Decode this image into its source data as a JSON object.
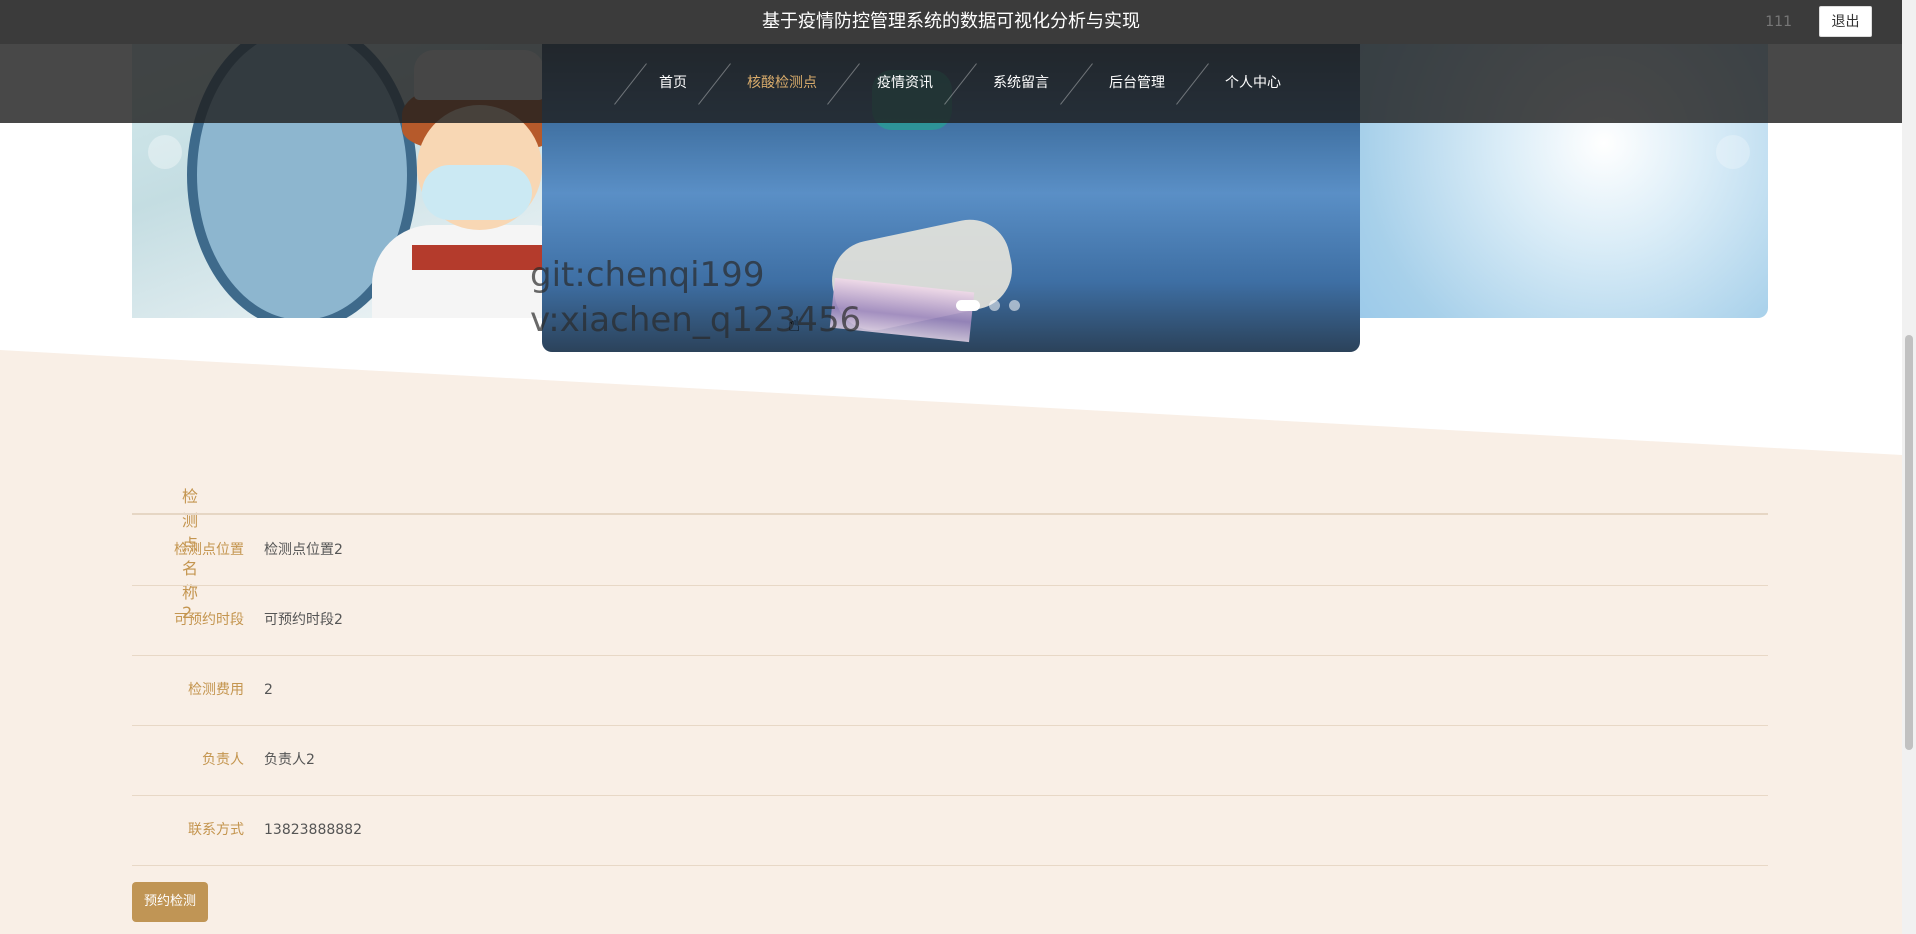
{
  "header": {
    "site_title": "基于疫情防控管理系统的数据可视化分析与实现",
    "username": "111",
    "logout_label": "退出"
  },
  "nav": {
    "items": [
      {
        "label": "首页",
        "active": false
      },
      {
        "label": "核酸检测点",
        "active": true
      },
      {
        "label": "疫情资讯",
        "active": false
      },
      {
        "label": "系统留言",
        "active": false
      },
      {
        "label": "后台管理",
        "active": false
      },
      {
        "label": "个人中心",
        "active": false
      }
    ]
  },
  "carousel": {
    "watermark_line1": "git:chenqi199",
    "watermark_line2": "v:xiachen_q123456",
    "slide_count": 3,
    "active_slide": 1
  },
  "detail": {
    "title": "检测点名称2",
    "rows": [
      {
        "label": "检测点位置",
        "value": "检测点位置2"
      },
      {
        "label": "可预约时段",
        "value": "可预约时段2"
      },
      {
        "label": "检测费用",
        "value": "2"
      },
      {
        "label": "负责人",
        "value": "负责人2"
      },
      {
        "label": "联系方式",
        "value": "13823888882"
      }
    ],
    "book_button_label": "预约检测"
  },
  "colors": {
    "accent": "#c4954f",
    "button": "#c09555",
    "beige_bg": "#f9efe6",
    "topbar": "#3b3b3b"
  }
}
